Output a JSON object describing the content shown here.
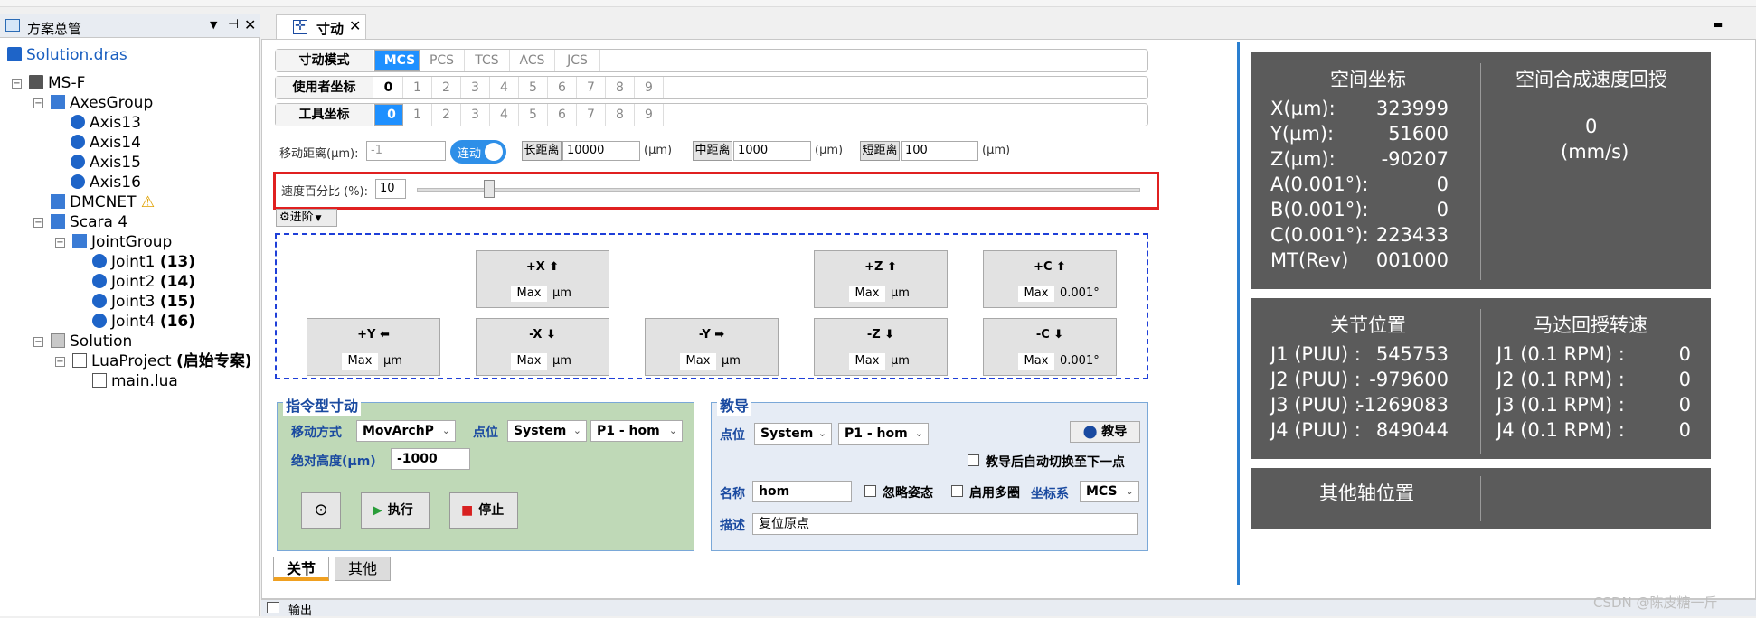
{
  "left_panel": {
    "title": "方案总管",
    "tree": [
      {
        "label": "Solution.dras"
      },
      {
        "label": "MS-F"
      },
      {
        "label": "AxesGroup"
      },
      {
        "label": "Axis13"
      },
      {
        "label": "Axis14"
      },
      {
        "label": "Axis15"
      },
      {
        "label": "Axis16"
      },
      {
        "label": "DMCNET"
      },
      {
        "label": "Scara 4"
      },
      {
        "label": "JointGroup"
      },
      {
        "label": "Joint1",
        "bold": "(13)"
      },
      {
        "label": "Joint2",
        "bold": "(14)"
      },
      {
        "label": "Joint3",
        "bold": "(15)"
      },
      {
        "label": "Joint4",
        "bold": "(16)"
      },
      {
        "label": "Solution"
      },
      {
        "label": "LuaProject",
        "bold": "(启始专案)"
      },
      {
        "label": "main.lua"
      }
    ]
  },
  "doc_tab": {
    "label": "寸动"
  },
  "modes": {
    "jog_mode_label": "寸动模式",
    "jog_modes": [
      "MCS",
      "PCS",
      "TCS",
      "ACS",
      "JCS"
    ],
    "user_coord_label": "使用者坐标",
    "tool_coord_label": "工具坐标",
    "digits": [
      "0",
      "1",
      "2",
      "3",
      "4",
      "5",
      "6",
      "7",
      "8",
      "9"
    ]
  },
  "distance": {
    "label": "移动距离(µm):",
    "value": "-1",
    "toggle": "连动",
    "long_label": "长距离",
    "long_value": "10000",
    "mid_label": "中距离",
    "mid_value": "1000",
    "short_label": "短距离",
    "short_value": "100",
    "unit": "(µm)"
  },
  "speed": {
    "label": "速度百分比 (%):",
    "value": "10",
    "percent": 10
  },
  "advanced": {
    "label": "进阶"
  },
  "jog_buttons": {
    "px": {
      "label": "+X",
      "max": "Max",
      "unit": "µm"
    },
    "pz": {
      "label": "+Z",
      "max": "Max",
      "unit": "µm"
    },
    "pc": {
      "label": "+C",
      "max": "Max",
      "unit": "0.001°"
    },
    "py": {
      "label": "+Y",
      "max": "Max",
      "unit": "µm"
    },
    "nx": {
      "label": "-X",
      "max": "Max",
      "unit": "µm"
    },
    "ny": {
      "label": "-Y",
      "max": "Max",
      "unit": "µm"
    },
    "nz": {
      "label": "-Z",
      "max": "Max",
      "unit": "µm"
    },
    "nc": {
      "label": "-C",
      "max": "Max",
      "unit": "0.001°"
    }
  },
  "cmd_jog": {
    "title": "指令型寸动",
    "move_label": "移动方式",
    "move_value": "MovArchP",
    "point_label": "点位",
    "point_sys": "System",
    "point_val": "P1 - hom",
    "height_label": "绝对高度(µm)",
    "height_value": "-1000",
    "exec": "执行",
    "stop": "停止"
  },
  "teach": {
    "title": "教导",
    "point_label": "点位",
    "point_sys": "System",
    "point_val": "P1 - hom",
    "teach_btn": "教导",
    "auto_next": "教导后自动切换至下一点",
    "name_label": "名称",
    "name_value": "hom",
    "ignore_pose": "忽略姿态",
    "multi_turn": "启用多圈",
    "coord_label": "坐标系",
    "coord_value": "MCS",
    "desc_label": "描述",
    "desc_value": "复位原点"
  },
  "space": {
    "title": "空间坐标",
    "rows": [
      {
        "k": "X(µm):",
        "v": "323999"
      },
      {
        "k": "Y(µm):",
        "v": "51600"
      },
      {
        "k": "Z(µm):",
        "v": "-90207"
      },
      {
        "k": "A(0.001°):",
        "v": "0"
      },
      {
        "k": "B(0.001°):",
        "v": "0"
      },
      {
        "k": "C(0.001°):",
        "v": "223433"
      },
      {
        "k": "MT(Rev)",
        "v": "001000"
      }
    ],
    "speed_title": "空间合成速度回授",
    "speed_value": "0",
    "speed_unit": "(mm/s)"
  },
  "joints": {
    "title": "关节位置",
    "rows": [
      {
        "k": "J1 (PUU) :",
        "v": "545753"
      },
      {
        "k": "J2 (PUU) :",
        "v": "-979600"
      },
      {
        "k": "J3 (PUU) :",
        "v": "-1269083"
      },
      {
        "k": "J4 (PUU) :",
        "v": "849044"
      }
    ],
    "motor_title": "马达回授转速",
    "motor_rows": [
      {
        "k": "J1 (0.1 RPM) :",
        "v": "0"
      },
      {
        "k": "J2 (0.1 RPM) :",
        "v": "0"
      },
      {
        "k": "J3 (0.1 RPM) :",
        "v": "0"
      },
      {
        "k": "J4 (0.1 RPM) :",
        "v": "0"
      }
    ]
  },
  "other_axes": {
    "title": "其他轴位置"
  },
  "bottom_tabs": [
    "关节",
    "其他"
  ],
  "output": {
    "label": "输出"
  },
  "watermark": "CSDN @陈皮糖一斤",
  "colors": {
    "accent": "#1e90ff",
    "panel": "#5b5b5b",
    "highlight": "#e02020",
    "group_green": "#bfd9b7"
  }
}
